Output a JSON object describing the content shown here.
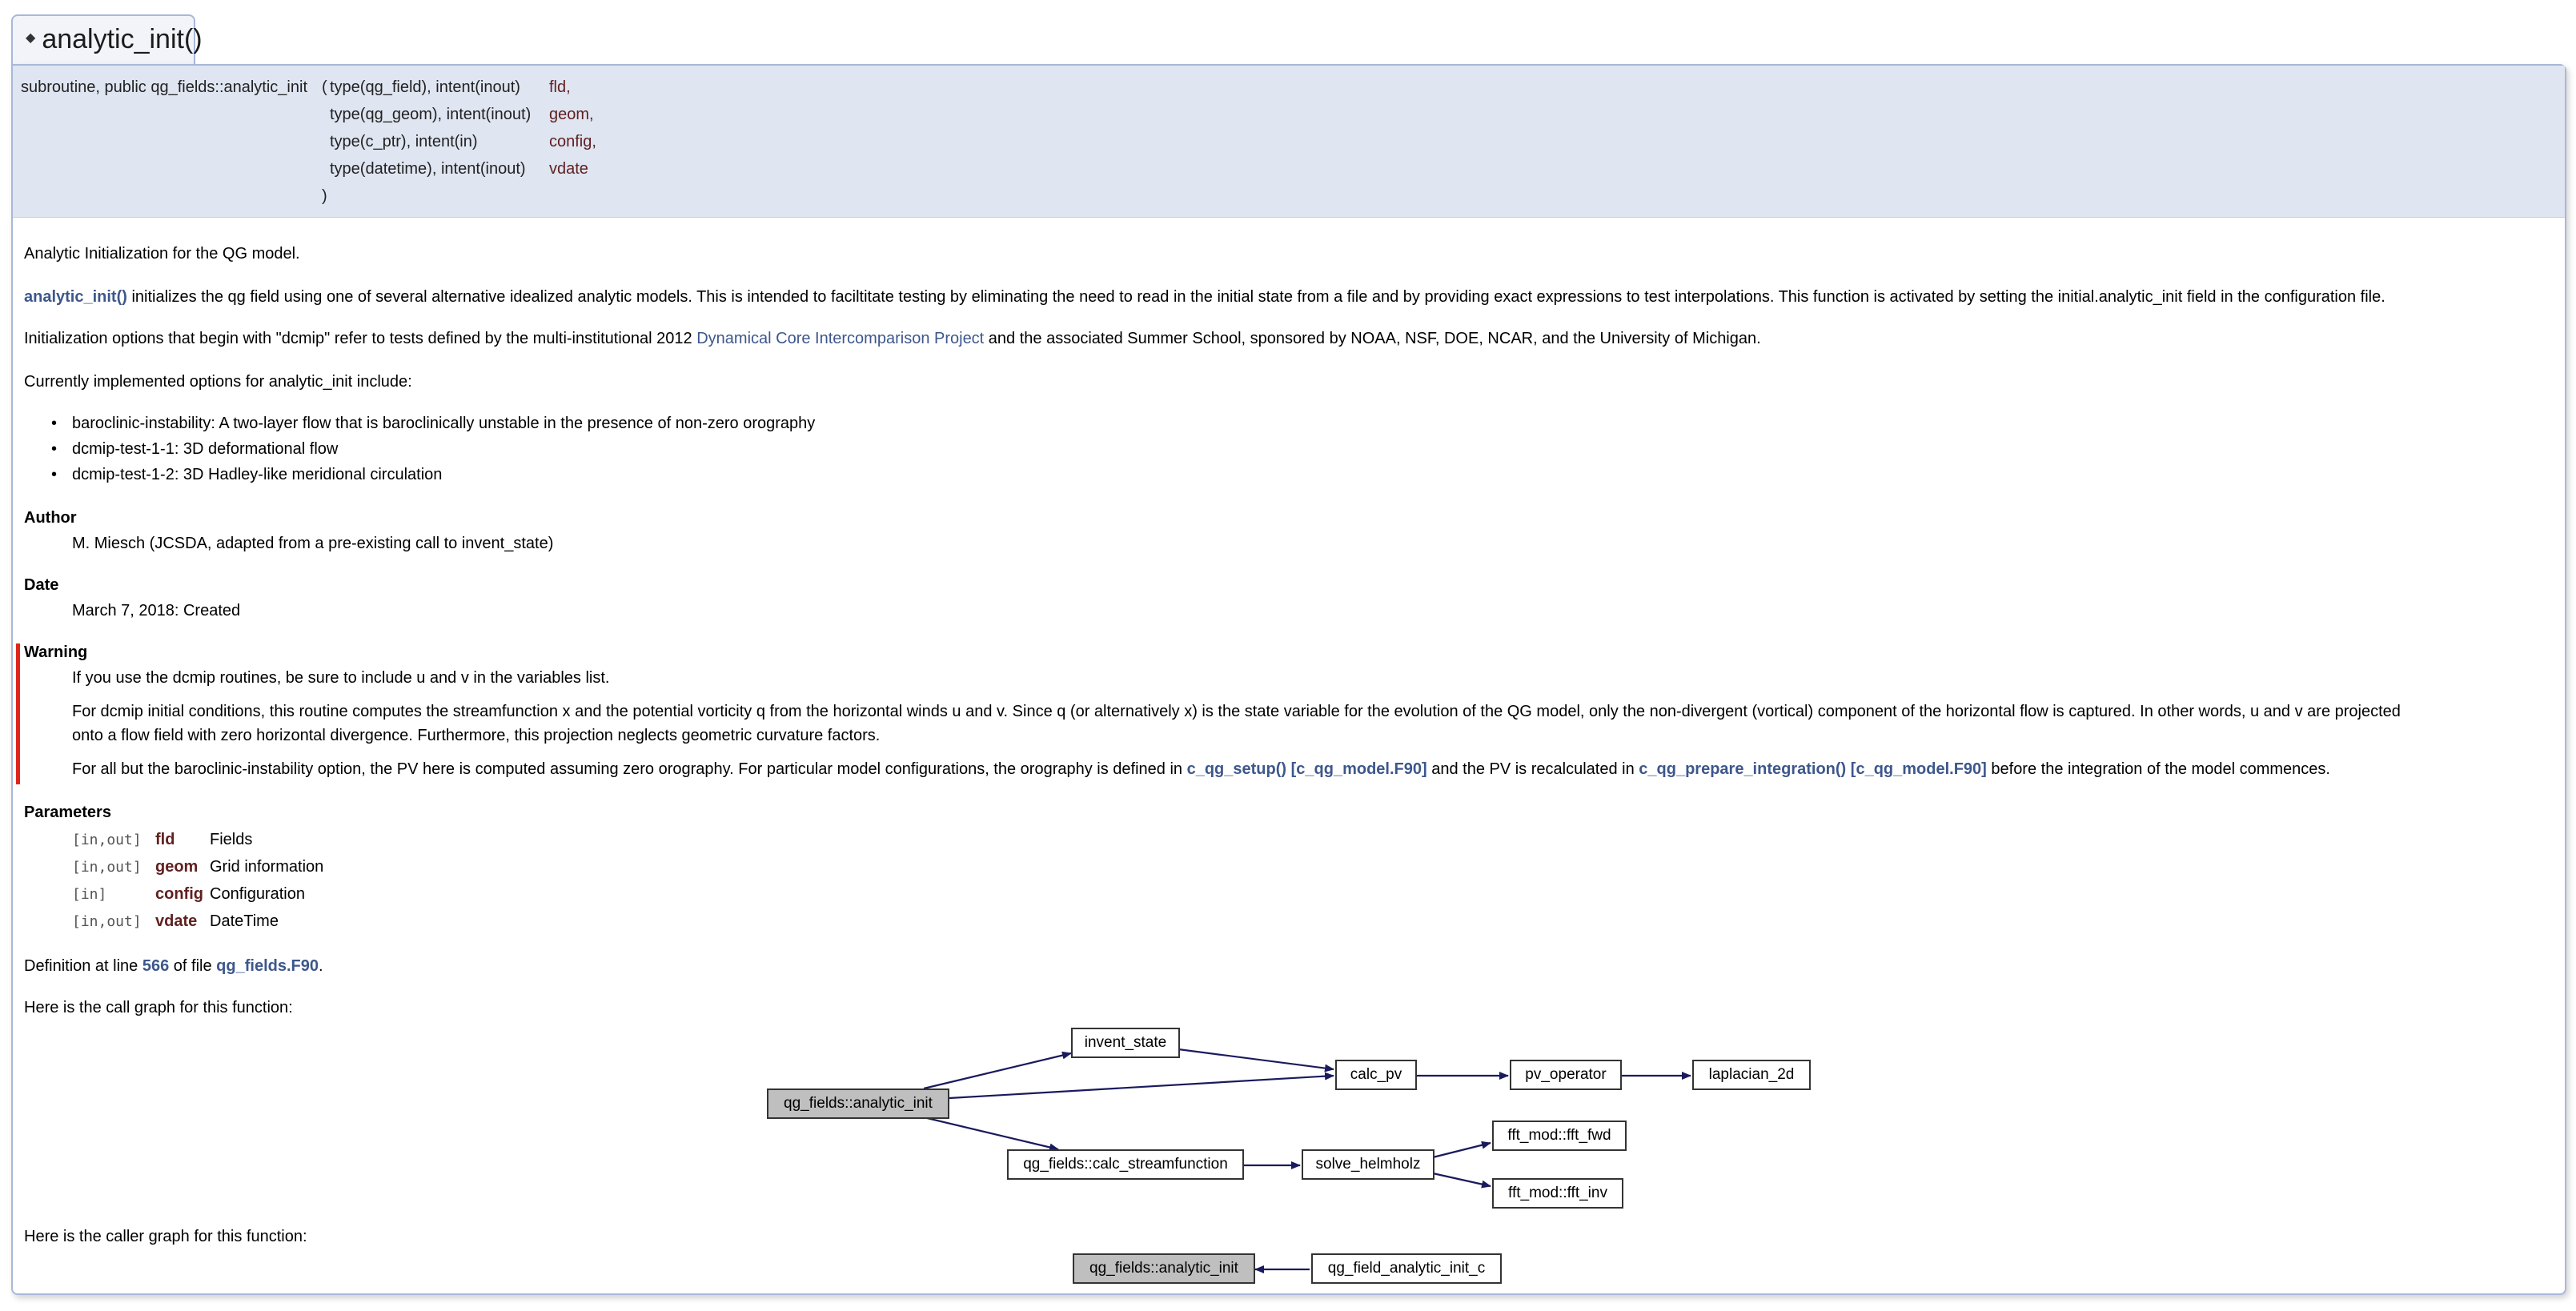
{
  "title": "analytic_init()",
  "signature": {
    "prefix": "subroutine, public qg_fields::analytic_init",
    "open_paren": "(",
    "close_paren": ")",
    "params": [
      {
        "type": "type(qg_field), intent(inout)",
        "name": "fld,"
      },
      {
        "type": "type(qg_geom), intent(inout)",
        "name": "geom,"
      },
      {
        "type": "type(c_ptr), intent(in)",
        "name": "config,"
      },
      {
        "type": "type(datetime), intent(inout)",
        "name": "vdate"
      }
    ]
  },
  "brief": "Analytic Initialization for the QG model.",
  "para1": {
    "link": "analytic_init()",
    "text": " initializes the qg field using one of several alternative idealized analytic models. This is intended to faciltitate testing by eliminating the need to read in the initial state from a file and by providing exact expressions to test interpolations. This function is activated by setting the initial.analytic_init field in the configuration file."
  },
  "para2": {
    "before": "Initialization options that begin with \"dcmip\" refer to tests defined by the multi-institutional 2012 ",
    "link": "Dynamical Core Intercomparison Project",
    "after": " and the associated Summer School, sponsored by NOAA, NSF, DOE, NCAR, and the University of Michigan."
  },
  "para3": "Currently implemented options for analytic_init include:",
  "options": [
    "baroclinic-instability: A two-layer flow that is baroclinically unstable in the presence of non-zero orography",
    "dcmip-test-1-1: 3D deformational flow",
    "dcmip-test-1-2: 3D Hadley-like meridional circulation"
  ],
  "author": {
    "heading": "Author",
    "text": "M. Miesch (JCSDA, adapted from a pre-existing call to invent_state)"
  },
  "date": {
    "heading": "Date",
    "text": "March 7, 2018: Created"
  },
  "warning": {
    "heading": "Warning",
    "line1": "If you use the dcmip routines, be sure to include u and v in the variables list.",
    "line2a": "For dcmip initial conditions, this routine computes the streamfunction x and the potential vorticity q from the horizontal winds u and v. Since q (or alternatively x) is the state variable for the evolution of the QG model, only the non-divergent (vortical) component of the horizontal flow is captured. In other words, u and v are projected",
    "line2b": "onto a flow field with zero horizontal divergence. Furthermore, this projection neglects geometric curvature factors.",
    "line3_before": "For all but the baroclinic-instability option, the PV here is computed assuming zero orography. For particular model configurations, the orography is defined in ",
    "line3_link1": "c_qg_setup()",
    "line3_link1b": "[c_qg_model.F90]",
    "line3_mid": " and the PV is recalculated in ",
    "line3_link2": "c_qg_prepare_integration()",
    "line3_link2b": "[c_qg_model.F90]",
    "line3_after": " before the integration of the model commences."
  },
  "parameters": {
    "heading": "Parameters",
    "items": [
      {
        "dir": "[in,out]",
        "name": "fld",
        "desc": "Fields"
      },
      {
        "dir": "[in,out]",
        "name": "geom",
        "desc": "Grid information"
      },
      {
        "dir": "[in]",
        "name": "config",
        "desc": "Configuration"
      },
      {
        "dir": "[in,out]",
        "name": "vdate",
        "desc": "DateTime"
      }
    ]
  },
  "definition": {
    "before": "Definition at line ",
    "line": "566",
    "mid": " of file ",
    "file": "qg_fields.F90",
    "after": "."
  },
  "call_graph_label": "Here is the call graph for this function:",
  "caller_graph_label": "Here is the caller graph for this function:",
  "call_graph": {
    "nodes": [
      "qg_fields::analytic_init",
      "invent_state",
      "calc_pv",
      "pv_operator",
      "laplacian_2d",
      "qg_fields::calc_streamfunction",
      "solve_helmholz",
      "fft_mod::fft_fwd",
      "fft_mod::fft_inv"
    ]
  },
  "caller_graph": {
    "nodes": [
      "qg_fields::analytic_init",
      "qg_field_analytic_init_c"
    ]
  },
  "colors": {
    "link": "#3d578c",
    "param_name": "#602020",
    "warning_bar": "#e0261b",
    "proto_bg": "#dfe5f1",
    "root_node": "#bfbfbf"
  }
}
